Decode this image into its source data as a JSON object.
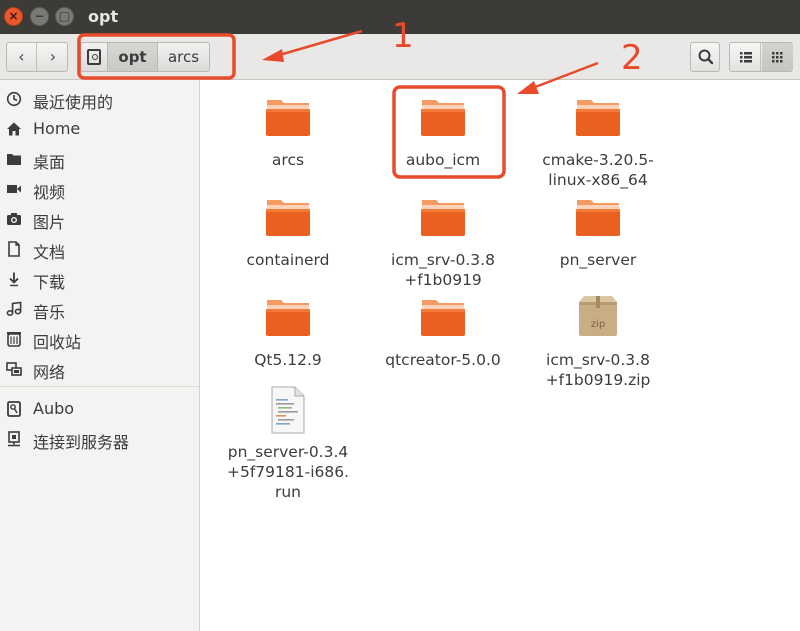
{
  "window": {
    "title": "opt",
    "close_glyph": "×",
    "minimize_glyph": "−",
    "maximize_glyph": "□"
  },
  "toolbar": {
    "back_glyph": "‹",
    "forward_glyph": "›",
    "breadcrumbs": [
      "opt",
      "arcs"
    ],
    "search_icon": "search-icon",
    "view_list_icon": "list-view-icon",
    "view_grid_icon": "grid-view-icon"
  },
  "sidebar": {
    "items": [
      {
        "label": "最近使用的",
        "icon": "clock-icon"
      },
      {
        "label": "Home",
        "icon": "home-icon"
      },
      {
        "label": "桌面",
        "icon": "desktop-folder-icon"
      },
      {
        "label": "视频",
        "icon": "video-icon"
      },
      {
        "label": "图片",
        "icon": "camera-icon"
      },
      {
        "label": "文档",
        "icon": "document-icon"
      },
      {
        "label": "下载",
        "icon": "download-icon"
      },
      {
        "label": "音乐",
        "icon": "music-icon"
      },
      {
        "label": "回收站",
        "icon": "trash-icon"
      },
      {
        "label": "网络",
        "icon": "network-icon"
      },
      {
        "label": "Aubo",
        "icon": "drive-icon"
      },
      {
        "label": "连接到服务器",
        "icon": "server-icon"
      }
    ]
  },
  "files": [
    {
      "name_lines": [
        "arcs"
      ],
      "type": "folder"
    },
    {
      "name_lines": [
        "aubo_icm"
      ],
      "type": "folder"
    },
    {
      "name_lines": [
        "cmake-3.20.5-",
        "linux-x86_64"
      ],
      "type": "folder"
    },
    {
      "name_lines": [
        "containerd"
      ],
      "type": "folder"
    },
    {
      "name_lines": [
        "icm_srv-0.3.8",
        "+f1b0919"
      ],
      "type": "folder"
    },
    {
      "name_lines": [
        "pn_server"
      ],
      "type": "folder"
    },
    {
      "name_lines": [
        "Qt5.12.9"
      ],
      "type": "folder"
    },
    {
      "name_lines": [
        "qtcreator-5.0.0"
      ],
      "type": "folder"
    },
    {
      "name_lines": [
        "icm_srv-0.3.8",
        "+f1b0919.zip"
      ],
      "type": "zip",
      "badge": "zip"
    },
    {
      "name_lines": [
        "pn_server-0.3.4",
        "+5f79181-i686.",
        "run"
      ],
      "type": "script"
    }
  ],
  "annotations": {
    "label_1": "1",
    "label_2": "2",
    "color": "#e84a2c"
  },
  "colors": {
    "folder_top": "#f47c3c",
    "folder_body": "#e85d20",
    "titlebar": "#3c3b37",
    "close_button": "#e9572d"
  }
}
